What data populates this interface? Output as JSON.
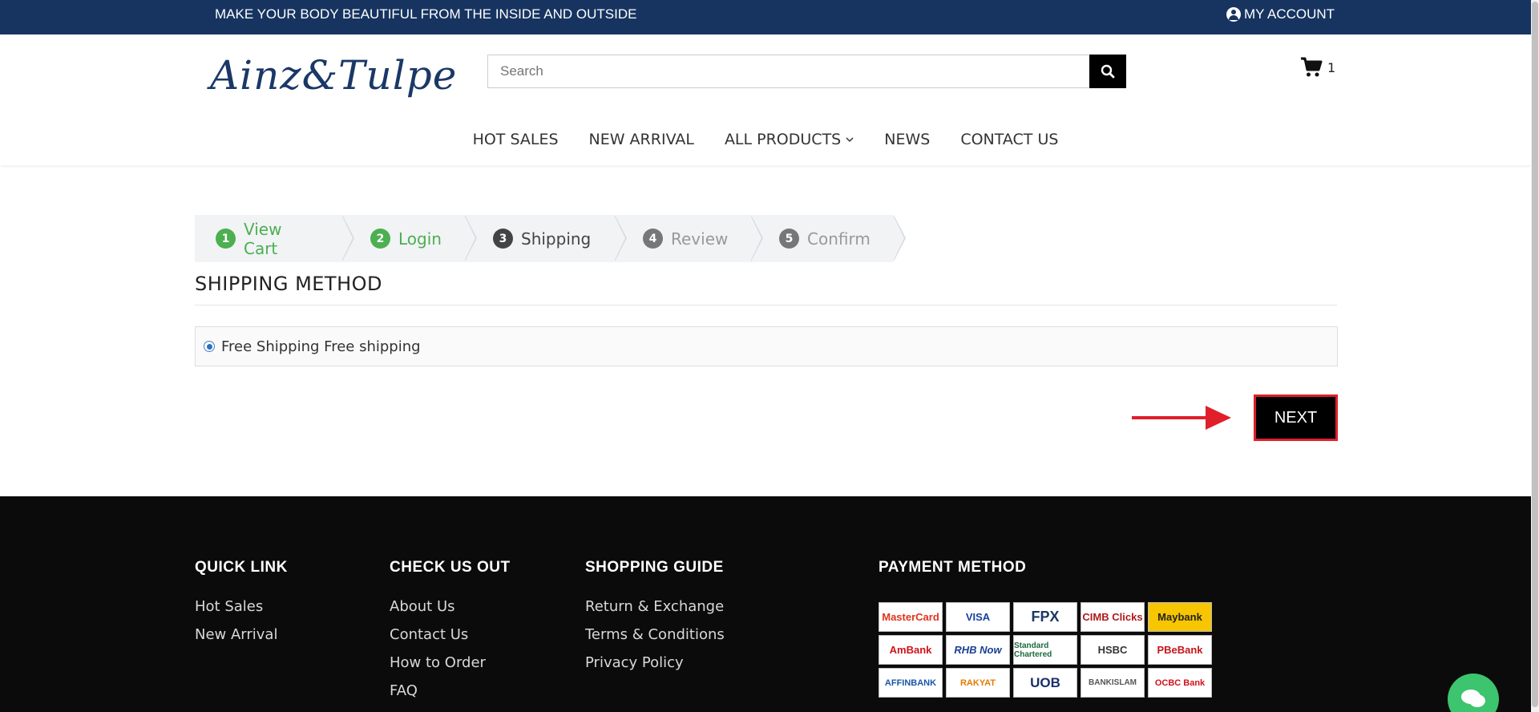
{
  "topbar": {
    "message": "MAKE YOUR BODY BEAUTIFUL FROM THE INSIDE AND OUTSIDE",
    "account_label": "MY ACCOUNT"
  },
  "header": {
    "logo_text": "Ainz&Tulpe",
    "search_placeholder": "Search",
    "cart_count": "1"
  },
  "nav": {
    "items": [
      {
        "label": "HOT SALES"
      },
      {
        "label": "NEW ARRIVAL"
      },
      {
        "label": "ALL PRODUCTS"
      },
      {
        "label": "NEWS"
      },
      {
        "label": "CONTACT US"
      }
    ]
  },
  "checkout_steps": [
    {
      "num": "1",
      "label": "View Cart",
      "state": "done"
    },
    {
      "num": "2",
      "label": "Login",
      "state": "done"
    },
    {
      "num": "3",
      "label": "Shipping",
      "state": "active"
    },
    {
      "num": "4",
      "label": "Review",
      "state": "todo"
    },
    {
      "num": "5",
      "label": "Confirm",
      "state": "todo"
    }
  ],
  "shipping": {
    "title": "SHIPPING METHOD",
    "option_label": "Free Shipping Free shipping",
    "next_label": "NEXT"
  },
  "footer": {
    "quick_link": {
      "heading": "QUICK LINK",
      "links": [
        "Hot Sales",
        "New Arrival"
      ]
    },
    "check_us_out": {
      "heading": "CHECK US OUT",
      "links": [
        "About Us",
        "Contact Us",
        "How to Order",
        "FAQ"
      ]
    },
    "shopping_guide": {
      "heading": "SHOPPING GUIDE",
      "links": [
        "Return & Exchange",
        "Terms & Conditions",
        "Privacy Policy"
      ]
    },
    "payment": {
      "heading": "PAYMENT METHOD",
      "methods": [
        "MasterCard",
        "VISA",
        "FPX",
        "CIMB Clicks",
        "Maybank",
        "AmBank",
        "RHB Now",
        "Standard Chartered",
        "HSBC",
        "PBeBank",
        "AFFINBANK",
        "RAKYAT",
        "UOB",
        "BANKISLAM",
        "OCBC Bank"
      ]
    }
  },
  "colors": {
    "topbar": "#173460",
    "step_done": "#4caf50",
    "next_border": "#e01f2b",
    "chat": "#3cc46e"
  }
}
